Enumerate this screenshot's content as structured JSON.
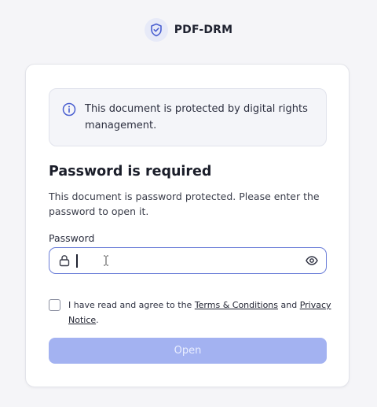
{
  "brand": {
    "name": "PDF-DRM",
    "icon": "shield-check-icon"
  },
  "notice": {
    "icon": "info-icon",
    "text": "This document is protected by digital rights management."
  },
  "form": {
    "title": "Password is required",
    "description": "This document is password protected. Please enter the password to open it.",
    "password_label": "Password",
    "password_value": "",
    "agree_prefix": "I have read and agree to the ",
    "terms_link": "Terms & Conditions",
    "agree_middle": " and ",
    "privacy_link": "Privacy Notice",
    "agree_suffix": ".",
    "agree_checked": false,
    "open_label": "Open",
    "open_enabled": false
  },
  "colors": {
    "accent": "#6a7dd8",
    "button_disabled": "#a3b2f1",
    "background": "#f5f5f8"
  }
}
